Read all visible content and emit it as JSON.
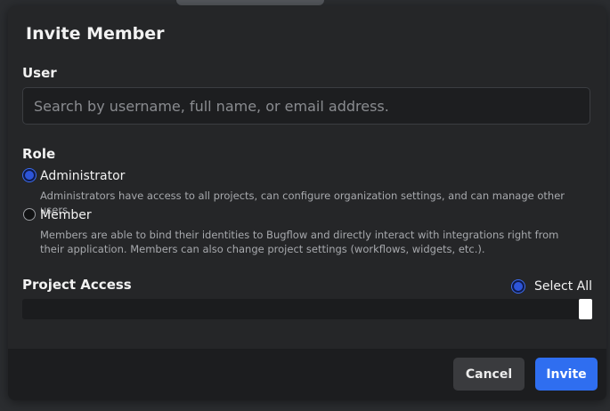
{
  "modal": {
    "title": "Invite Member",
    "user": {
      "label": "User",
      "placeholder": "Search by username, full name, or email address.",
      "value": ""
    },
    "role": {
      "label": "Role",
      "options": [
        {
          "label": "Administrator",
          "description": "Administrators have access to all projects, can configure organization settings, and can manage other users.",
          "selected": true
        },
        {
          "label": "Member",
          "description": "Members are able to bind their identities to Bugflow and directly interact with integrations right from their application. Members can also change project settings (workflows, widgets, etc.).",
          "selected": false
        }
      ]
    },
    "project_access": {
      "label": "Project Access",
      "select_all_label": "Select All",
      "select_all_checked": true
    },
    "footer": {
      "cancel_label": "Cancel",
      "invite_label": "Invite"
    }
  },
  "colors": {
    "accent": "#2f6ef0",
    "modal_bg": "#252628",
    "footer_bg": "#1c1d1f"
  }
}
